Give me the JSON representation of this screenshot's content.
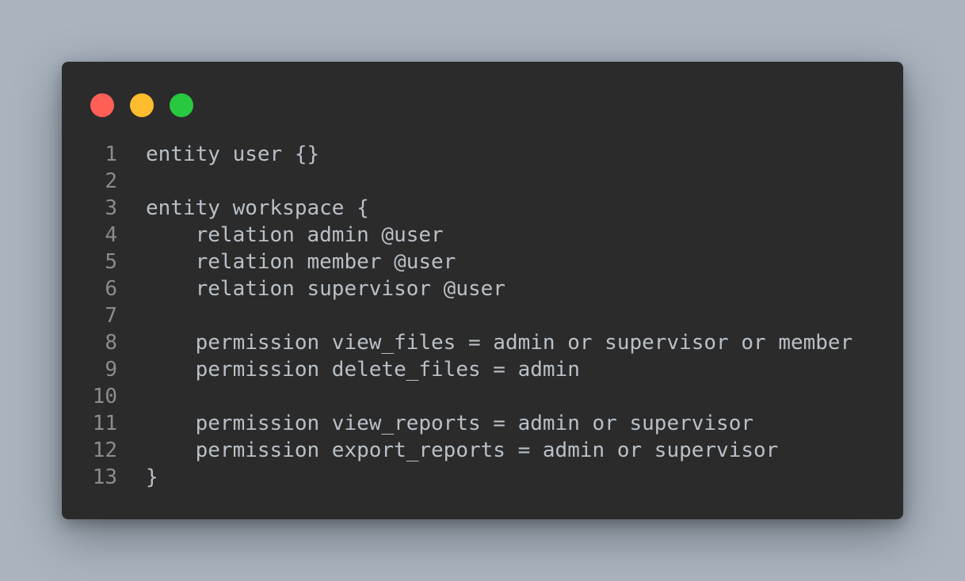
{
  "window": {
    "controls": [
      {
        "name": "close-dot",
        "color": "#ff5f57"
      },
      {
        "name": "minimize-dot",
        "color": "#febc2e"
      },
      {
        "name": "maximize-dot",
        "color": "#28c840"
      }
    ]
  },
  "code": {
    "lines": [
      {
        "num": "1",
        "text": "entity user {}"
      },
      {
        "num": "2",
        "text": ""
      },
      {
        "num": "3",
        "text": "entity workspace {"
      },
      {
        "num": "4",
        "text": "    relation admin @user"
      },
      {
        "num": "5",
        "text": "    relation member @user"
      },
      {
        "num": "6",
        "text": "    relation supervisor @user"
      },
      {
        "num": "7",
        "text": ""
      },
      {
        "num": "8",
        "text": "    permission view_files = admin or supervisor or member"
      },
      {
        "num": "9",
        "text": "    permission delete_files = admin"
      },
      {
        "num": "10",
        "text": ""
      },
      {
        "num": "11",
        "text": "    permission view_reports = admin or supervisor"
      },
      {
        "num": "12",
        "text": "    permission export_reports = admin or supervisor"
      },
      {
        "num": "13",
        "text": "}"
      }
    ]
  }
}
